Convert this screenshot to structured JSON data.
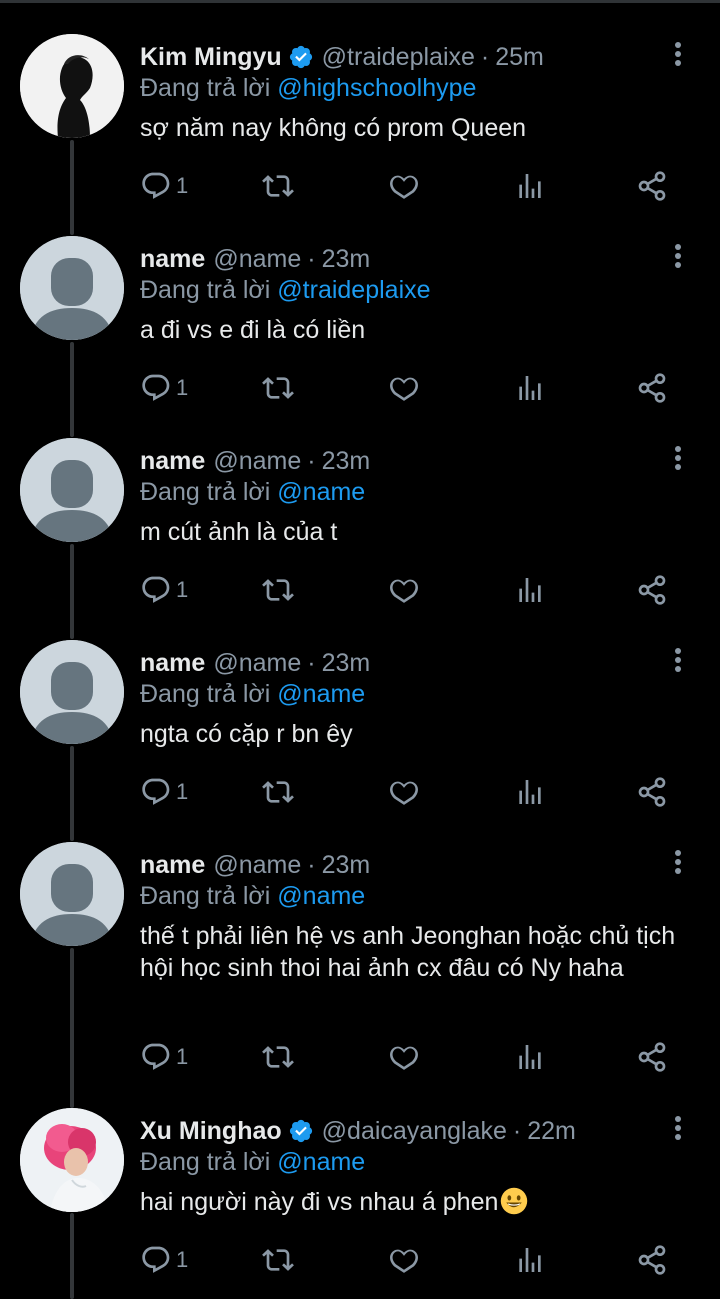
{
  "tweets": [
    {
      "name": "Kim Mingyu",
      "verified": true,
      "handle": "@traideplaixe",
      "time": "25m",
      "replying_label": "Đang trả lời",
      "replying_to": "@highschoolhype",
      "text": "sợ năm nay không có prom Queen",
      "reply_count": "1",
      "avatar": "silhouette-photo"
    },
    {
      "name": "name",
      "verified": false,
      "handle": "@name",
      "time": "23m",
      "replying_label": "Đang trả lời",
      "replying_to": "@traideplaixe",
      "text": "a đi vs e đi là có liền",
      "reply_count": "1",
      "avatar": "default-avatar"
    },
    {
      "name": "name",
      "verified": false,
      "handle": "@name",
      "time": "23m",
      "replying_label": "Đang trả lời",
      "replying_to": "@name",
      "text": "m cút ảnh là của t",
      "reply_count": "1",
      "avatar": "default-avatar"
    },
    {
      "name": "name",
      "verified": false,
      "handle": "@name",
      "time": "23m",
      "replying_label": "Đang trả lời",
      "replying_to": "@name",
      "text": "ngta có cặp r bn êy",
      "reply_count": "1",
      "avatar": "default-avatar"
    },
    {
      "name": "name",
      "verified": false,
      "handle": "@name",
      "time": "23m",
      "replying_label": "Đang trả lời",
      "replying_to": "@name",
      "text": "thế t phải liên hệ vs anh Jeonghan hoặc chủ tịch hội học sinh thoi hai ảnh cx đâu có Ny haha",
      "reply_count": "1",
      "avatar": "default-avatar"
    },
    {
      "name": "Xu Minghao",
      "verified": true,
      "handle": "@daicayanglake",
      "time": "22m",
      "replying_label": "Đang trả lời",
      "replying_to": "@name",
      "text": "hai người này đi vs nhau á phen",
      "text_emoji": "smiling-face-emoji",
      "reply_count": "1",
      "avatar": "pink-hair-photo"
    }
  ],
  "colors": {
    "background": "#000000",
    "text": "#e7e9ea",
    "muted": "#8b98a5",
    "accent": "#1d9bf0",
    "thread_line": "#333639"
  },
  "icons": [
    "reply-icon",
    "retweet-icon",
    "like-icon",
    "analytics-icon",
    "share-icon",
    "more-icon",
    "verified-badge-icon"
  ]
}
